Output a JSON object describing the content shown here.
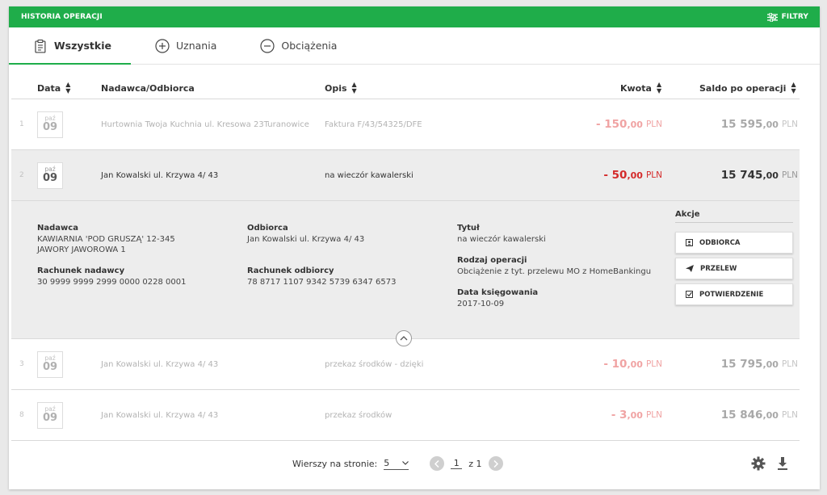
{
  "header": {
    "title": "HISTORIA OPERACJI",
    "filters_label": "FILTRY"
  },
  "tabs": [
    {
      "label": "Wszystkie",
      "icon": "clipboard-icon"
    },
    {
      "label": "Uznania",
      "icon": "plus-circle-icon"
    },
    {
      "label": "Obciążenia",
      "icon": "minus-circle-icon"
    }
  ],
  "columns": {
    "date": "Data",
    "party": "Nadawca/Odbiorca",
    "desc": "Opis",
    "amount": "Kwota",
    "balance": "Saldo po operacji"
  },
  "rows": [
    {
      "num": "1",
      "month": "paź",
      "day": "09",
      "party": "Hurtownia Twoja Kuchnia ul. Kresowa 23Turanowice",
      "desc": "Faktura F/43/54325/DFE",
      "amount_int": "- 150",
      "amount_dec": ",00",
      "amount_cur": "PLN",
      "balance_int": "15 595",
      "balance_dec": ",00",
      "balance_cur": "PLN"
    },
    {
      "num": "2",
      "month": "paź",
      "day": "09",
      "party": "Jan Kowalski ul. Krzywa 4/ 43",
      "desc": "na wieczór kawalerski",
      "amount_int": "- 50",
      "amount_dec": ",00",
      "amount_cur": "PLN",
      "balance_int": "15 745",
      "balance_dec": ",00",
      "balance_cur": "PLN"
    },
    {
      "num": "3",
      "month": "paź",
      "day": "09",
      "party": "Jan Kowalski ul. Krzywa 4/ 43",
      "desc": "przekaz środków - dzięki",
      "amount_int": "- 10",
      "amount_dec": ",00",
      "amount_cur": "PLN",
      "balance_int": "15 795",
      "balance_dec": ",00",
      "balance_cur": "PLN"
    },
    {
      "num": "8",
      "month": "paź",
      "day": "09",
      "party": "Jan Kowalski ul. Krzywa 4/ 43",
      "desc": "przekaz środków",
      "amount_int": "- 3",
      "amount_dec": ",00",
      "amount_cur": "PLN",
      "balance_int": "15 846",
      "balance_dec": ",00",
      "balance_cur": "PLN"
    }
  ],
  "details": {
    "sender_label": "Nadawca",
    "sender_value": "KAWIARNIA 'POD GRUSZĄ' 12-345 JAWORY JAWOROWA 1",
    "sender_account_label": "Rachunek nadawcy",
    "sender_account_value": "30 9999 9999 2999 0000 0228 0001",
    "recipient_label": "Odbiorca",
    "recipient_value": "Jan Kowalski ul. Krzywa 4/ 43",
    "recipient_account_label": "Rachunek odbiorcy",
    "recipient_account_value": "78 8717 1107 9342 5739 6347 6573",
    "title_label": "Tytuł",
    "title_value": "na wieczór kawalerski",
    "op_type_label": "Rodzaj operacji",
    "op_type_value": "Obciążenie z tyt. przelewu MO z HomeBankingu",
    "booking_date_label": "Data księgowania",
    "booking_date_value": "2017-10-09",
    "actions_title": "Akcje",
    "actions": [
      "ODBIORCA",
      "PRZELEW",
      "POTWIERDZENIE"
    ]
  },
  "footer": {
    "rows_per_page_label": "Wierszy na stronie:",
    "rows_per_page_value": "5",
    "page_current": "1",
    "page_of": "z 1"
  },
  "colors": {
    "brand": "#1fad4a",
    "debit": "#d42a2a"
  }
}
